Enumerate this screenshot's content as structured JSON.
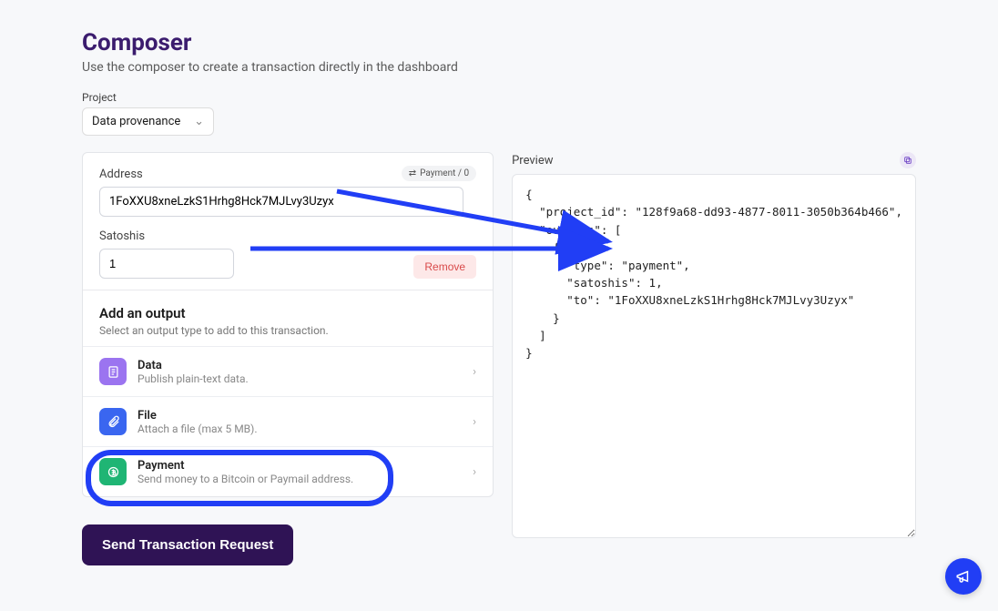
{
  "header": {
    "title": "Composer",
    "subtitle": "Use the composer to create a transaction directly in the dashboard"
  },
  "project": {
    "label": "Project",
    "selected": "Data provenance"
  },
  "form": {
    "badge": "Payment / 0",
    "address_label": "Address",
    "address_value": "1FoXXU8xneLzkS1Hrhg8Hck7MJLvy3Uzyx",
    "satoshis_label": "Satoshis",
    "satoshis_value": "1",
    "remove_label": "Remove"
  },
  "add": {
    "title": "Add an output",
    "subtitle": "Select an output type to add to this transaction.",
    "items": [
      {
        "title": "Data",
        "desc": "Publish plain-text data."
      },
      {
        "title": "File",
        "desc": "Attach a file (max 5 MB)."
      },
      {
        "title": "Payment",
        "desc": "Send money to a Bitcoin or Paymail address."
      }
    ]
  },
  "preview": {
    "label": "Preview",
    "json": "{\n  \"project_id\": \"128f9a68-dd93-4877-8011-3050b364b466\",\n  \"outputs\": [\n    {\n      \"type\": \"payment\",\n      \"satoshis\": 1,\n      \"to\": \"1FoXXU8xneLzkS1Hrhg8Hck7MJLvy3Uzyx\"\n    }\n  ]\n}"
  },
  "actions": {
    "send": "Send Transaction Request"
  }
}
